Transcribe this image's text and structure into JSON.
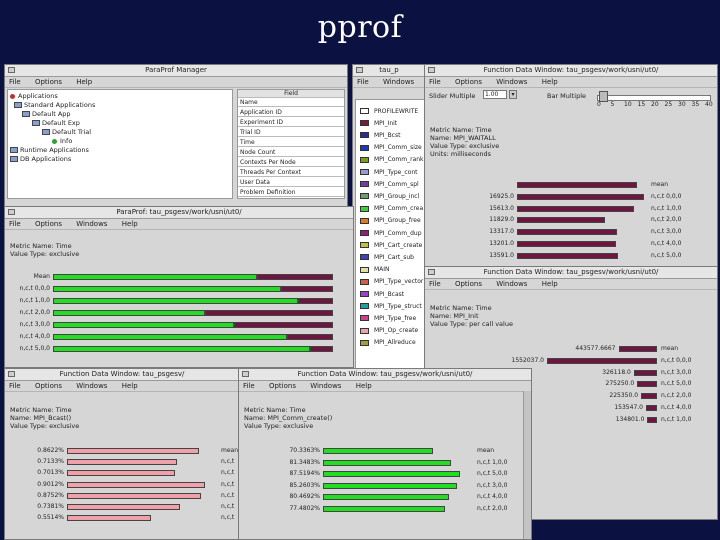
{
  "slide": {
    "title": "pprof"
  },
  "colors": {
    "green": "#22dd22",
    "maroon": "#6e1640",
    "pink": "#f0a0a8",
    "background": "#0b1140"
  },
  "manager": {
    "title": "ParaProf Manager",
    "menu": [
      "File",
      "Options",
      "Help"
    ],
    "tree": [
      "Applications",
      "Standard Applications",
      "Default App",
      "Default Exp",
      "Default Trial",
      "Info",
      "Runtime Applications",
      "DB Applications"
    ],
    "field_header": "Field",
    "fields": [
      "Name",
      "Application ID",
      "Experiment ID",
      "Trial ID",
      "Time",
      "Node Count",
      "Contexts Per Node",
      "Threads Per Context",
      "User Data",
      "Problem Definition"
    ]
  },
  "legend_win": {
    "title": "tau_p",
    "menu": [
      "File",
      "Windows"
    ],
    "items": [
      {
        "label": "PROFILEWRITE",
        "color": "#ffffff"
      },
      {
        "label": "MPI_Init",
        "color": "#7a1a3a"
      },
      {
        "label": "MPI_Bcst",
        "color": "#2a2a9a"
      },
      {
        "label": "MPI_Comm_size",
        "color": "#1a3aba"
      },
      {
        "label": "MPI_Comm_rank",
        "color": "#7aa01a"
      },
      {
        "label": "MPI_Type_cont",
        "color": "#9a9ad0"
      },
      {
        "label": "MPI_Comm_spl",
        "color": "#7a3aa0"
      },
      {
        "label": "MPI_Group_incl",
        "color": "#6aa06a"
      },
      {
        "label": "MPI_Comm_crea",
        "color": "#3ad03a"
      },
      {
        "label": "MPI_Group_free",
        "color": "#e07a1a"
      },
      {
        "label": "MPI_Comm_dup",
        "color": "#9a1a7a"
      },
      {
        "label": "MPI_Cart_create",
        "color": "#c0c040"
      },
      {
        "label": "MPI_Cart_sub",
        "color": "#4040c0"
      },
      {
        "label": "MAIN",
        "color": "#e0e0a0"
      },
      {
        "label": "MPI_Type_vector",
        "color": "#d06040"
      },
      {
        "label": "MPI_Bcast",
        "color": "#a040d0"
      },
      {
        "label": "MPI_Type_struct",
        "color": "#20a0a0"
      },
      {
        "label": "MPI_Type_free",
        "color": "#d04090"
      },
      {
        "label": "MPI_Op_create",
        "color": "#f0a0a8"
      },
      {
        "label": "MPI_Allreduce",
        "color": "#a0a040"
      }
    ]
  },
  "func_top": {
    "title": "Function Data Window: tau_psgesv/work/usni/ut0/",
    "menu": [
      "File",
      "Options",
      "Windows",
      "Help"
    ],
    "slider_label": "Slider Multiple",
    "slider_value": "1.00",
    "bar_multiple_label": "Bar Multiple",
    "scale_labels": [
      "0",
      "5",
      "10",
      "15",
      "20",
      "25",
      "30",
      "35",
      "40"
    ],
    "info": [
      "Metric Name: Time",
      "Name: MPI_WAITALL",
      "Value Type: exclusive",
      "Units: milliseconds"
    ],
    "rows": [
      {
        "value": "",
        "label": "mean",
        "frac": 0.92
      },
      {
        "value": "16925.0",
        "label": "n,c,t 0,0,0",
        "frac": 0.98
      },
      {
        "value": "15613.0",
        "label": "n,c,t 1,0,0",
        "frac": 0.9
      },
      {
        "value": "11829.0",
        "label": "n,c,t 2,0,0",
        "frac": 0.68
      },
      {
        "value": "13317.0",
        "label": "n,c,t 3,0,0",
        "frac": 0.77
      },
      {
        "value": "13201.0",
        "label": "n,c,t 4,0,0",
        "frac": 0.76
      },
      {
        "value": "13591.0",
        "label": "n,c,t 5,0,0",
        "frac": 0.78
      }
    ]
  },
  "main_win": {
    "title": "ParaProf: tau_psgesv/work/usni/ut0/",
    "menu": [
      "File",
      "Options",
      "Windows",
      "Help"
    ],
    "info": [
      "Metric Name: Time",
      "Value Type: exclusive"
    ],
    "rows": [
      {
        "label": "Mean",
        "green": 0.7,
        "maroon": 0.26
      },
      {
        "label": "n,c,t 0,0,0",
        "green": 0.78,
        "maroon": 0.18
      },
      {
        "label": "n,c,t 1,0,0",
        "green": 0.84,
        "maroon": 0.12
      },
      {
        "label": "n,c,t 2,0,0",
        "green": 0.52,
        "maroon": 0.44
      },
      {
        "label": "n,c,t 3,0,0",
        "green": 0.62,
        "maroon": 0.34
      },
      {
        "label": "n,c,t 4,0,0",
        "green": 0.8,
        "maroon": 0.16
      },
      {
        "label": "n,c,t 5,0,0",
        "green": 0.88,
        "maroon": 0.08
      }
    ]
  },
  "func_mid": {
    "title": "Function Data Window: tau_psgesv/work/usni/ut0/",
    "menu": [
      "File",
      "Options",
      "Windows",
      "Help"
    ],
    "info": [
      "Metric Name: Time",
      "Name: MPI_Init",
      "Value Type: per call value"
    ],
    "rows": [
      {
        "value": "443577.6667",
        "label": "mean",
        "frac": 0.35
      },
      {
        "value": "1552037.0",
        "label": "n,c,t 0,0,0",
        "frac": 1.0
      },
      {
        "value": "326118.0",
        "label": "n,c,t 3,0,0",
        "frac": 0.21
      },
      {
        "value": "275250.0",
        "label": "n,c,t 5,0,0",
        "frac": 0.18
      },
      {
        "value": "225350.0",
        "label": "n,c,t 2,0,0",
        "frac": 0.145
      },
      {
        "value": "153547.0",
        "label": "n,c,t 4,0,0",
        "frac": 0.1
      },
      {
        "value": "134801.0",
        "label": "n,c,t 1,0,0",
        "frac": 0.087
      }
    ]
  },
  "func_bl": {
    "title": "Function Data Window: tau_psgesv/",
    "menu": [
      "File",
      "Options",
      "Windows",
      "Help"
    ],
    "info": [
      "Metric Name: Time",
      "Name: MPI_Bcast()",
      "Value Type: exclusive"
    ],
    "rows": [
      {
        "value": "0.8622%",
        "label": "mean",
        "frac": 0.88
      },
      {
        "value": "0.7133%",
        "label": "n,c,t",
        "frac": 0.73
      },
      {
        "value": "0.7013%",
        "label": "n,c,t",
        "frac": 0.72
      },
      {
        "value": "0.9012%",
        "label": "n,c,t",
        "frac": 0.92
      },
      {
        "value": "0.8752%",
        "label": "n,c,t",
        "frac": 0.89
      },
      {
        "value": "0.7381%",
        "label": "n,c,t",
        "frac": 0.75
      },
      {
        "value": "0.5514%",
        "label": "n,c,t",
        "frac": 0.56
      }
    ]
  },
  "func_bm": {
    "title": "Function Data Window: tau_psgesv/work/usni/ut0/",
    "menu": [
      "File",
      "Options",
      "Windows",
      "Help"
    ],
    "info": [
      "Metric Name: Time",
      "Name: MPI_Comm_create()",
      "Value Type: exclusive"
    ],
    "rows": [
      {
        "value": "70.3363%",
        "label": "mean",
        "frac": 0.73
      },
      {
        "value": "81.3483%",
        "label": "n,c,t 1,0,0",
        "frac": 0.85
      },
      {
        "value": "87.5194%",
        "label": "n,c,t 5,0,0",
        "frac": 0.91
      },
      {
        "value": "85.2603%",
        "label": "n,c,t 3,0,0",
        "frac": 0.89
      },
      {
        "value": "80.4692%",
        "label": "n,c,t 4,0,0",
        "frac": 0.84
      },
      {
        "value": "77.4802%",
        "label": "n,c,t 2,0,0",
        "frac": 0.81
      }
    ]
  }
}
